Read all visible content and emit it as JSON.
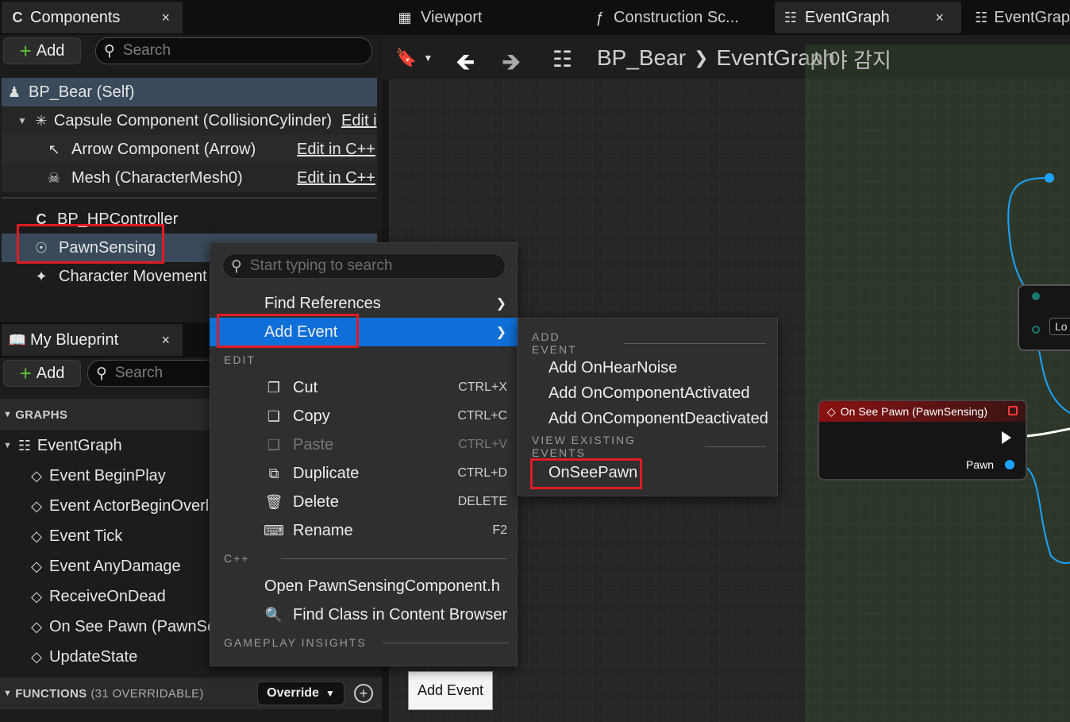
{
  "components_panel": {
    "tab_label": "Components",
    "close": "×",
    "add_label": "Add",
    "search_placeholder": "Search",
    "self_item": "BP_Bear (Self)",
    "capsule": "Capsule Component (CollisionCylinder)",
    "capsule_edit": "Edit i",
    "arrow": "Arrow Component (Arrow)",
    "mesh": "Mesh (CharacterMesh0)",
    "edit_cpp": "Edit in C++",
    "hp_controller": "BP_HPController",
    "pawn_sensing": "PawnSensing",
    "char_movement": "Character Movement"
  },
  "my_blueprint": {
    "tab_label": "My Blueprint",
    "close": "×",
    "add_label": "Add",
    "search_placeholder": "Search",
    "graphs_header": "GRAPHS",
    "event_graph": "EventGraph",
    "events": [
      "Event BeginPlay",
      "Event ActorBeginOverla",
      "Event Tick",
      "Event AnyDamage",
      "ReceiveOnDead",
      "On See Pawn (PawnSe",
      "UpdateState"
    ],
    "functions_header": "FUNCTIONS",
    "functions_count": "(31 OVERRIDABLE)",
    "override_label": "Override"
  },
  "editor_tabs": {
    "viewport": "Viewport",
    "construction": "Construction Sc...",
    "event_graph": "EventGraph",
    "event_graph2": "EventGrap",
    "close": "×"
  },
  "breadcrumb": {
    "root": "BP_Bear",
    "current": "EventGraph",
    "comment_overlay": "시야 감지"
  },
  "context_menu": {
    "search_placeholder": "Start typing to search",
    "find_references": "Find References",
    "add_event": "Add Event",
    "edit_header": "EDIT",
    "cut": "Cut",
    "cut_key": "CTRL+X",
    "copy": "Copy",
    "copy_key": "CTRL+C",
    "paste": "Paste",
    "paste_key": "CTRL+V",
    "duplicate": "Duplicate",
    "duplicate_key": "CTRL+D",
    "delete": "Delete",
    "delete_key": "DELETE",
    "rename": "Rename",
    "rename_key": "F2",
    "cpp_header": "C++",
    "open_header": "Open PawnSensingComponent.h",
    "find_class": "Find Class in Content Browser",
    "gameplay_header": "GAMEPLAY INSIGHTS"
  },
  "submenu": {
    "add_event_header": "ADD EVENT",
    "items": [
      "Add OnHearNoise",
      "Add OnComponentActivated",
      "Add OnComponentDeactivated"
    ],
    "existing_header": "VIEW EXISTING EVENTS",
    "existing": "OnSeePawn"
  },
  "node": {
    "title": "On See Pawn (PawnSensing)",
    "pawn_pin": "Pawn",
    "header_color": "#7a1010"
  },
  "graph_node_partial": "Lo",
  "tooltip": "Add Event",
  "colors": {
    "highlight": "#0e6fd8",
    "outline": "#e01b24",
    "pin_blue": "#1aa3ff"
  }
}
